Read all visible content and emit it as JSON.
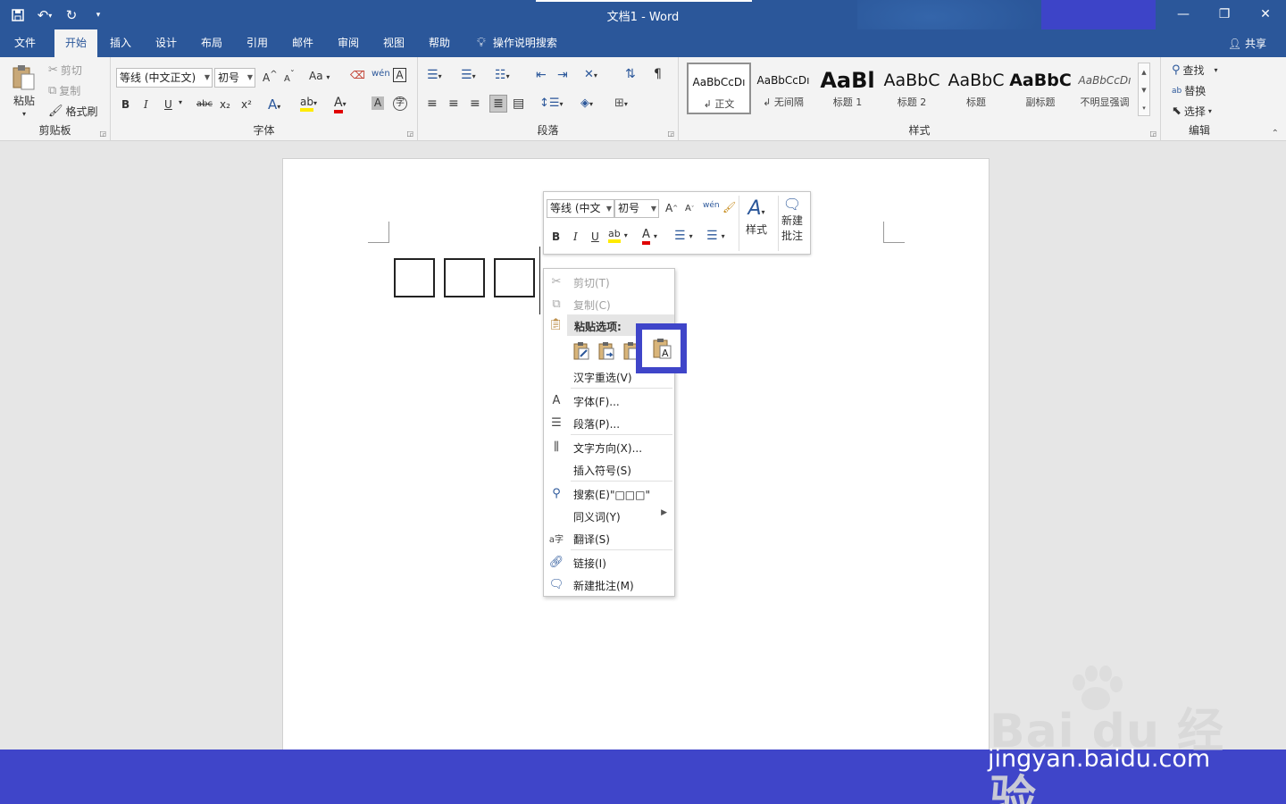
{
  "window": {
    "title": "文档1  -  Word",
    "controls": [
      "—",
      "❐",
      "✕"
    ]
  },
  "quick_access": [
    "save-icon",
    "undo-icon",
    "redo-icon",
    "customize-icon"
  ],
  "tabs": [
    {
      "label": "文件",
      "active": false
    },
    {
      "label": "开始",
      "active": true
    },
    {
      "label": "插入",
      "active": false
    },
    {
      "label": "设计",
      "active": false
    },
    {
      "label": "布局",
      "active": false
    },
    {
      "label": "引用",
      "active": false
    },
    {
      "label": "邮件",
      "active": false
    },
    {
      "label": "审阅",
      "active": false
    },
    {
      "label": "视图",
      "active": false
    },
    {
      "label": "帮助",
      "active": false
    }
  ],
  "tell_me": "操作说明搜索",
  "share": "共享",
  "ribbon": {
    "clipboard": {
      "label": "剪贴板",
      "paste": "粘贴",
      "cut": "剪切",
      "copy": "复制",
      "format_painter": "格式刷"
    },
    "font": {
      "label": "字体",
      "font_name": "等线 (中文正文)",
      "font_size": "初号",
      "grow": "A",
      "shrink": "A",
      "change_case": "Aa",
      "bold": "B",
      "italic": "I",
      "underline": "U",
      "strike": "abc",
      "sub": "x₂",
      "sup": "x²"
    },
    "paragraph": {
      "label": "段落"
    },
    "styles": {
      "label": "样式",
      "items": [
        {
          "preview": "AaBbCcDı",
          "name": "↲ 正文",
          "selected": true
        },
        {
          "preview": "AaBbCcDı",
          "name": "↲ 无间隔",
          "selected": false
        },
        {
          "preview": "AaBl",
          "name": "标题 1",
          "selected": false
        },
        {
          "preview": "AaBbC",
          "name": "标题 2",
          "selected": false
        },
        {
          "preview": "AaBbC",
          "name": "标题",
          "selected": false
        },
        {
          "preview": "AaBbC",
          "name": "副标题",
          "selected": false
        },
        {
          "preview": "AaBbCcDı",
          "name": "不明显强调",
          "selected": false
        }
      ]
    },
    "editing": {
      "label": "编辑",
      "find": "查找",
      "replace": "替换",
      "select": "选择"
    }
  },
  "mini_toolbar": {
    "font_name": "等线 (中文",
    "font_size": "初号",
    "styles": "样式",
    "new_comment": "新建",
    "new_comment_2": "批注"
  },
  "context_menu": {
    "cut": "剪切(T)",
    "copy": "复制(C)",
    "paste_header": "粘贴选项:",
    "reconvert": "汉字重选(V)",
    "font": "字体(F)...",
    "paragraph": "段落(P)...",
    "text_direction": "文字方向(X)...",
    "insert_symbol": "插入符号(S)",
    "search": "搜索(E)\"□□□\"",
    "synonyms": "同义词(Y)",
    "translate": "翻译(S)",
    "link": "链接(I)",
    "new_comment": "新建批注(M)"
  },
  "watermark": {
    "brand": "Bai du 经验",
    "url": "jingyan.baidu.com"
  },
  "colors": {
    "word_blue": "#2b579a",
    "highlight": "#3f45c9"
  }
}
